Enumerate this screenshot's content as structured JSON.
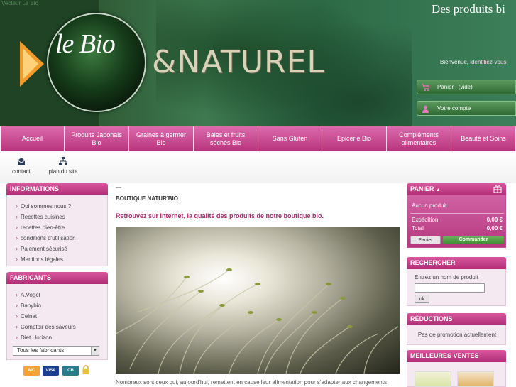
{
  "header": {
    "top_link": "Vecteur Le Bio",
    "tagline": "Des produits bi",
    "logo_text": "le Bio",
    "logo_naturel": "&NATUREL",
    "welcome": "Bienvenue,",
    "login_link": "identifiez-vous",
    "cart_label": "Panier : (vide)",
    "account_label": "Votre compte"
  },
  "nav": {
    "items": [
      {
        "label": "Accueil"
      },
      {
        "label": "Produits Japonais Bio"
      },
      {
        "label": "Graines à germer Bio"
      },
      {
        "label": "Baies et fruits séchés Bio"
      },
      {
        "label": "Sans Gluten"
      },
      {
        "label": "Epicerie Bio"
      },
      {
        "label": "Compléments alimentaires"
      },
      {
        "label": "Beauté et Soins"
      }
    ]
  },
  "toolbar": {
    "contact": "contact",
    "sitemap": "plan du site"
  },
  "informations": {
    "title": "INFORMATIONS",
    "items": [
      "Qui sommes nous ?",
      "Recettes cuisines",
      "recettes bien-être",
      "conditions d'utilisation",
      "Paiement sécurisé",
      "Mentions légales"
    ]
  },
  "fabricants": {
    "title": "FABRICANTS",
    "items": [
      "A.Vogel",
      "Babybio",
      "Celnat",
      "Comptoir des saveurs",
      "Diet Horizon"
    ],
    "select": "Tous les fabricants"
  },
  "payments": [
    "MC",
    "VISA",
    "CB"
  ],
  "center": {
    "title": "BOUTIQUE NATUR'BIO",
    "intro": "Retrouvez sur Internet, la qualité des produits de notre boutique bio.",
    "text": "Nombreux sont ceux qui, aujourd'hui, remettent en cause leur alimentation pour s'adapter aux changements"
  },
  "cart": {
    "title": "PANIER",
    "empty": "Aucun produit",
    "shipping_label": "Expédition",
    "shipping_value": "0,00 €",
    "total_label": "Total",
    "total_value": "0,00 €",
    "cart_button": "Panier",
    "order_button": "Commander"
  },
  "search": {
    "title": "RECHERCHER",
    "label": "Entrez un nom de produit",
    "button": "ok"
  },
  "promo": {
    "title": "RÉDUCTIONS",
    "text": "Pas de promotion actuellement"
  },
  "best": {
    "title": "MEILLEURES VENTES"
  },
  "colors": {
    "pink": "#c23b86",
    "green": "#2f6a34",
    "light_pink": "#f5e9f1"
  }
}
